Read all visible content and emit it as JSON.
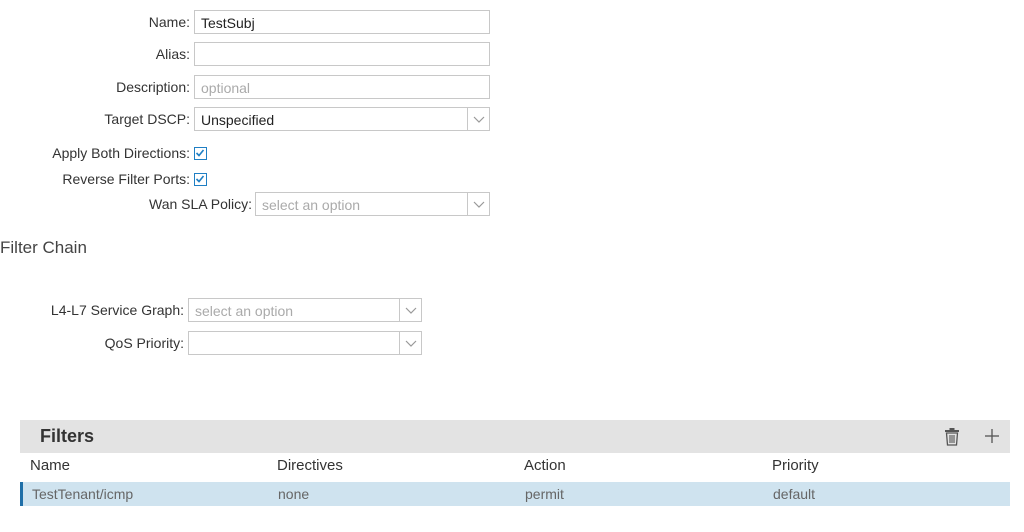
{
  "form": {
    "name": {
      "label": "Name:",
      "value": "TestSubj"
    },
    "alias": {
      "label": "Alias:",
      "value": ""
    },
    "description": {
      "label": "Description:",
      "placeholder": "optional"
    },
    "target_dscp": {
      "label": "Target DSCP:",
      "value": "Unspecified"
    },
    "apply_both_directions": {
      "label": "Apply Both Directions:",
      "checked": true
    },
    "reverse_filter_ports": {
      "label": "Reverse Filter Ports:",
      "checked": true
    },
    "wan_sla_policy": {
      "label": "Wan SLA Policy:",
      "placeholder": "select an option"
    }
  },
  "filter_chain": {
    "title": "Filter Chain",
    "service_graph": {
      "label": "L4-L7 Service Graph:",
      "placeholder": "select an option"
    },
    "qos_priority": {
      "label": "QoS Priority:",
      "value": ""
    }
  },
  "filters": {
    "title": "Filters",
    "icons": {
      "delete": "trash-icon",
      "add": "plus-icon"
    },
    "columns": [
      "Name",
      "Directives",
      "Action",
      "Priority"
    ],
    "rows": [
      {
        "name": "TestTenant/icmp",
        "directives": "none",
        "action": "permit",
        "priority": "default"
      }
    ]
  },
  "colors": {
    "accent": "#1f7fc4",
    "row_selected": "#cfe3ef",
    "header_bg": "#e3e3e3"
  }
}
